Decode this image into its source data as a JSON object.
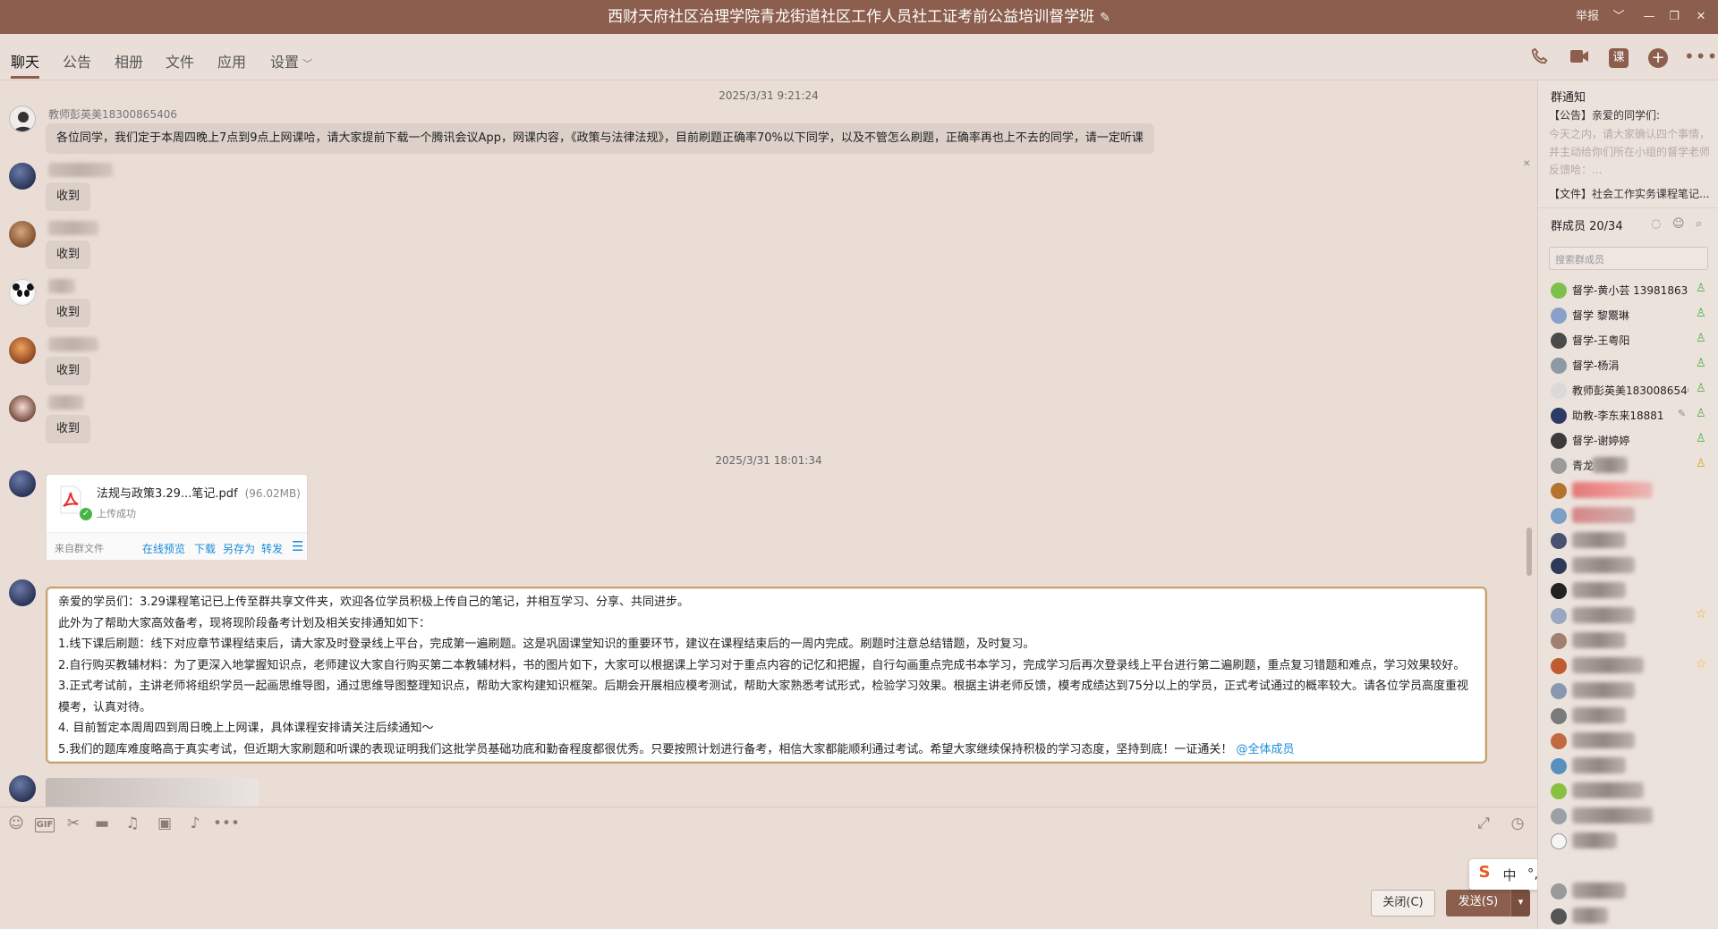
{
  "window": {
    "title": "西财天府社区治理学院青龙街道社区工作人员社工证考前公益培训督学班",
    "edit_icon": "✎",
    "report": "举报",
    "chevron": "﹀",
    "min": "—",
    "restore": "❐",
    "close": "✕"
  },
  "tabs": [
    {
      "label": "聊天"
    },
    {
      "label": "公告"
    },
    {
      "label": "相册"
    },
    {
      "label": "文件"
    },
    {
      "label": "应用"
    },
    {
      "label": "设置"
    }
  ],
  "toolbar": {
    "course": "课",
    "plus": "+",
    "more": "•••"
  },
  "chat": {
    "timestamp1": "2025/3/31 9:21:24",
    "timestamp2": "2025/3/31 18:01:34",
    "msg1": {
      "sender": "教师彭英美18300865406",
      "text": "各位同学，我们定于本周四晚上7点到9点上网课哈，请大家提前下载一个腾讯会议App，网课内容，《政策与法律法规》，目前刷题正确率70%以下同学，以及不管怎么刷题，正确率再也上不去的同学，请一定听课"
    },
    "receipts": [
      "收到",
      "收到",
      "收到",
      "收到",
      "收到"
    ],
    "file": {
      "name": "法规与政策3.29...笔记.pdf",
      "size": "(96.02MB)",
      "status": "上传成功",
      "from": "来自群文件",
      "actions": [
        "在线预览",
        "下载",
        "另存为",
        "转发"
      ]
    },
    "long": {
      "lines": [
        "亲爱的学员们：3.29课程笔记已上传至群共享文件夹，欢迎各位学员积极上传自己的笔记，并相互学习、分享、共同进步。",
        "此外为了帮助大家高效备考，现将现阶段备考计划及相关安排通知如下：",
        "1.线下课后刷题：线下对应章节课程结束后，请大家及时登录线上平台，完成第一遍刷题。这是巩固课堂知识的重要环节，建议在课程结束后的一周内完成。刷题时注意总结错题，及时复习。",
        "2.自行购买教辅材料：为了更深入地掌握知识点，老师建议大家自行购买第二本教辅材料，书的图片如下，大家可以根据课上学习对于重点内容的记忆和把握，自行勾画重点完成书本学习，完成学习后再次登录线上平台进行第二遍刷题，重点复习错题和难点，学习效果较好。",
        "3.正式考试前，主讲老师将组织学员一起画思维导图，通过思维导图整理知识点，帮助大家构建知识框架。后期会开展相应模考测试，帮助大家熟悉考试形式，检验学习效果。根据主讲老师反馈，模考成绩达到75分以上的学员，正式考试通过的概率较大。请各位学员高度重视模考，认真对待。",
        "4. 目前暂定本周周四到周日晚上上网课，具体课程安排请关注后续通知～"
      ],
      "last_line": "5.我们的题库难度略高于真实考试，但近期大家刷题和听课的表现证明我们这批学员基础功底和勤奋程度都很优秀。只要按照计划进行备考，相信大家都能顺利通过考试。希望大家继续保持积极的学习态度，坚持到底！一证通关！",
      "mention": "@全体成员"
    }
  },
  "input": {
    "gif": "GIF",
    "close": "关闭(C)",
    "send": "发送(S)",
    "send_arrow": "▾"
  },
  "ime": {
    "s": "S",
    "zh": "中",
    "punct": "°,",
    "mic": "🎙",
    "kbd": "⌨",
    "skin": "👕",
    "grid": "▦",
    "logo": "🎨"
  },
  "panel": {
    "notice_title": "群通知",
    "notice_line1": "【公告】亲爱的同学们:",
    "notice_body": "今天之内，请大家确认四个事情，并主动给你们所在小组的督学老师反馈哈：...",
    "file_line": "【文件】社会工作实务课程笔记...",
    "members_title": "群成员 20/34",
    "search_placeholder": "搜索群成员",
    "members": [
      {
        "name": "督学-黄小芸 13981863",
        "color": "#7fbf4d"
      },
      {
        "name": "督学 黎鬻琳",
        "color": "#8aa0c8"
      },
      {
        "name": "督学-王粤阳",
        "color": "#4a4a4a"
      },
      {
        "name": "督学-杨涓",
        "color": "#8d9aa5"
      },
      {
        "name": "教师彭英美18300865406",
        "color": "#d9d9d9"
      },
      {
        "name": "助教-李东来18881",
        "color": "#2d3a66"
      },
      {
        "name": "督学-谢婷婷",
        "color": "#3b3b3b"
      },
      {
        "name": "青龙",
        "color": "#9a9a9a"
      }
    ]
  }
}
